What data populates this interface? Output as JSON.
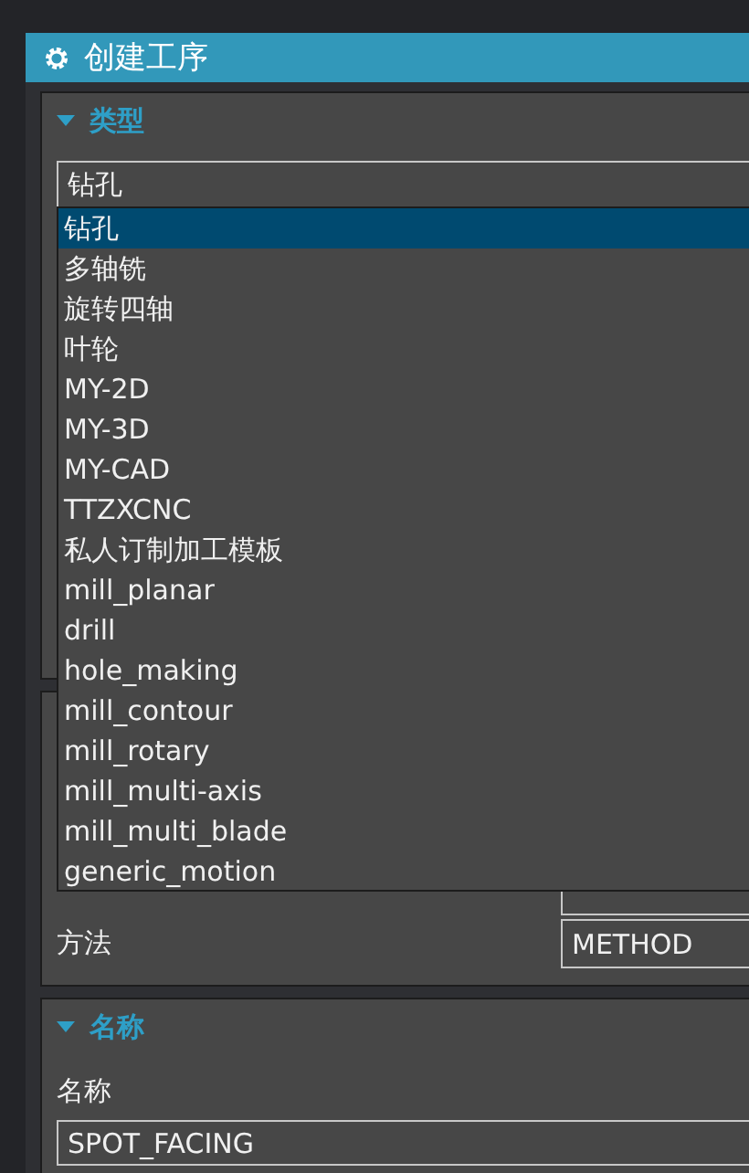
{
  "window": {
    "title": "创建工序"
  },
  "type_section": {
    "title": "类型",
    "expanded": true,
    "combo_value": "钻孔"
  },
  "dropdown": [
    {
      "label": "钻孔",
      "selected": true
    },
    {
      "label": "多轴铣",
      "selected": false
    },
    {
      "label": "旋转四轴",
      "selected": false
    },
    {
      "label": "叶轮",
      "selected": false
    },
    {
      "label": "MY-2D",
      "selected": false
    },
    {
      "label": "MY-3D",
      "selected": false
    },
    {
      "label": "MY-CAD",
      "selected": false
    },
    {
      "label": "TTZXCNC",
      "selected": false
    },
    {
      "label": "私人订制加工模板",
      "selected": false
    },
    {
      "label": "mill_planar",
      "selected": false
    },
    {
      "label": "drill",
      "selected": false
    },
    {
      "label": "hole_making",
      "selected": false
    },
    {
      "label": "mill_contour",
      "selected": false
    },
    {
      "label": "mill_rotary",
      "selected": false
    },
    {
      "label": "mill_multi-axis",
      "selected": false
    },
    {
      "label": "mill_multi_blade",
      "selected": false
    },
    {
      "label": "generic_motion",
      "selected": false
    }
  ],
  "location_section": {
    "rows": [
      {
        "label": "方法",
        "value": "METHOD"
      }
    ]
  },
  "name_section": {
    "title": "名称",
    "expanded": true,
    "label": "名称",
    "value": "SPOT_FACING"
  }
}
